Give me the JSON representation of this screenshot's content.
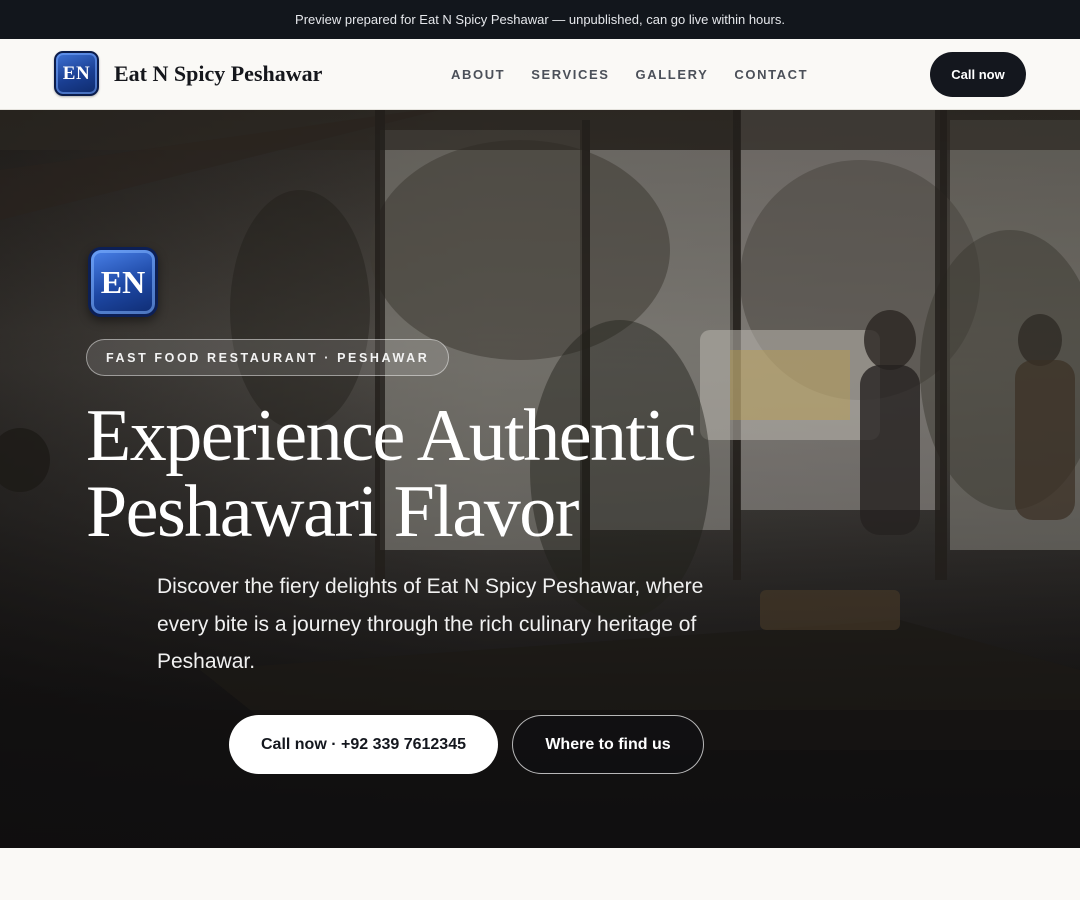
{
  "banner": {
    "text": "Preview prepared for Eat N Spicy Peshawar — unpublished, can go live within hours."
  },
  "header": {
    "logo_text": "EN",
    "brand": "Eat N Spicy Peshawar",
    "nav": [
      {
        "label": "ABOUT"
      },
      {
        "label": "SERVICES"
      },
      {
        "label": "GALLERY"
      },
      {
        "label": "CONTACT"
      }
    ],
    "cta_label": "Call now"
  },
  "hero": {
    "logo_text": "EN",
    "tag": "FAST FOOD RESTAURANT · PESHAWAR",
    "headline_line1": "Experience Authentic",
    "headline_line2": "Peshawari Flavor",
    "subtext": "Discover the fiery delights of Eat N Spicy Peshawar, where every bite is a journey through the rich culinary heritage of Peshawar.",
    "primary_cta": "Call now · +92 339 7612345",
    "secondary_cta": "Where to find us"
  },
  "colors": {
    "banner_bg": "#12161c",
    "nav_bg": "#faf9f6",
    "cta_dark": "#14171e",
    "logo_blue": "#1d47a3"
  }
}
